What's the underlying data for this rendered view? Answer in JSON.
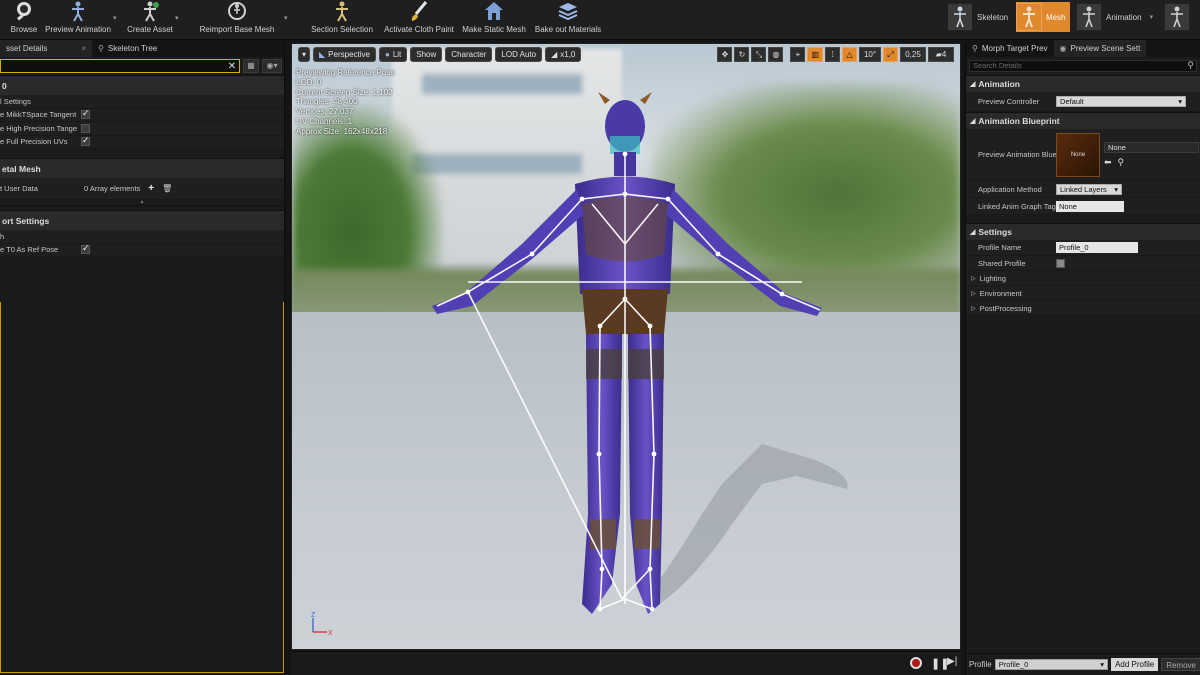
{
  "toolbar": {
    "buttons": [
      {
        "label": "Browse",
        "icon": "browse-icon"
      },
      {
        "label": "Preview Animation",
        "icon": "preview-animation-icon"
      },
      {
        "label": "Create Asset",
        "icon": "create-asset-icon"
      },
      {
        "label": "Reimport Base Mesh",
        "icon": "reimport-icon"
      },
      {
        "label": "Section Selection",
        "icon": "section-selection-icon"
      },
      {
        "label": "Activate Cloth Paint",
        "icon": "cloth-paint-icon"
      },
      {
        "label": "Make Static Mesh",
        "icon": "static-mesh-icon"
      },
      {
        "label": "Bake out Materials",
        "icon": "bake-materials-icon"
      }
    ],
    "modes": [
      {
        "label": "Skeleton",
        "active": false
      },
      {
        "label": "Mesh",
        "active": true
      },
      {
        "label": "Animation",
        "active": false
      }
    ],
    "accent": "#e0882c"
  },
  "left": {
    "tabs": [
      "sset Details",
      "Skeleton Tree"
    ],
    "section0": "0",
    "section0_rows": [
      {
        "label": "l Settings",
        "checked": null
      },
      {
        "label": "e MikkTSpace Tangent",
        "checked": true
      },
      {
        "label": "e High Precision Tange",
        "checked": false
      },
      {
        "label": "e Full Precision UVs",
        "checked": true
      }
    ],
    "section1": "etal Mesh",
    "user_data_label": "t User Data",
    "user_data_value": "0 Array elements",
    "section2": "ort Settings",
    "section2_rows": [
      {
        "label": "h",
        "checked": null
      },
      {
        "label": "e T0 As Ref Pose",
        "checked": true
      }
    ]
  },
  "viewport": {
    "buttons": [
      "Perspective",
      "Lit",
      "Show",
      "Character",
      "LOD Auto",
      "x1,0"
    ],
    "right_values": {
      "angle": "10°",
      "scale": "0,25",
      "camera_speed": "4"
    },
    "stats": [
      "Previewing Reference Pose",
      "LOD: 0",
      "Current Screen Size: 1,102",
      "Triangles: 48,400",
      "Vertices: 27,037",
      "UV Channels: 1",
      "Approx Size: 162x48x218"
    ],
    "axis": {
      "x": "X",
      "z": "Z"
    }
  },
  "right": {
    "tabs": [
      "Morph Target Prev",
      "Preview Scene Sett"
    ],
    "search_placeholder": "Search Details",
    "animation_header": "Animation",
    "preview_controller_label": "Preview Controller",
    "preview_controller_value": "Default",
    "anim_bp_header": "Animation Blueprint",
    "preview_anim_label": "Preview Animation Blue",
    "preview_anim_value": "None",
    "preview_anim_thumb": "None",
    "app_method_label": "Application Method",
    "app_method_value": "Linked Layers",
    "linked_tag_label": "Linked Anim Graph Tag",
    "linked_tag_value": "None",
    "settings_header": "Settings",
    "profile_name_label": "Profile Name",
    "profile_name_value": "Profile_0",
    "shared_profile_label": "Shared Profile",
    "tree_items": [
      "Lighting",
      "Environment",
      "PostProcessing"
    ],
    "bottom_profile_label": "Profile",
    "bottom_profile_value": "Profile_0",
    "add_profile": "Add Profile",
    "remove": "Remove"
  }
}
